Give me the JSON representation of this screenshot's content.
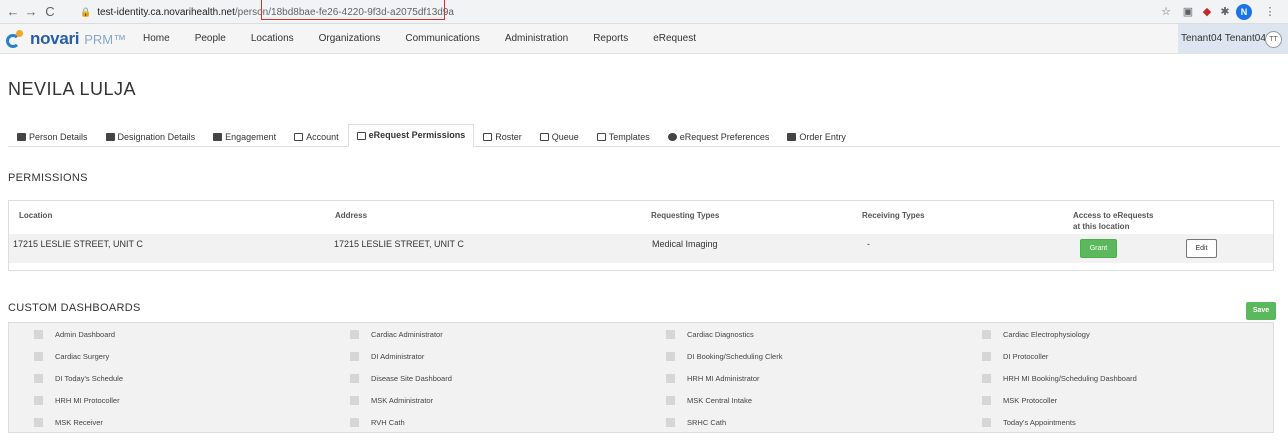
{
  "browser": {
    "back_icon": "←",
    "forward_icon": "→",
    "reload_icon": "C",
    "url_host": "test-identity.ca.novarihealth.net",
    "url_path": "/person/18bd8bae-fe26-4220-9f3d-a2075df13d9a",
    "profile_initial": "N"
  },
  "app": {
    "logo_word": "novari",
    "logo_product": "PRM™",
    "nav": [
      "Home",
      "People",
      "Locations",
      "Organizations",
      "Communications",
      "Administration",
      "Reports",
      "eRequest"
    ],
    "user_name": "Tenant04 Tenant04",
    "user_initials": "TT"
  },
  "person": {
    "name": "NEVILA LULJA"
  },
  "tabs": [
    {
      "label": "Person Details",
      "icon": "person-icon"
    },
    {
      "label": "Designation Details",
      "icon": "id-card-icon"
    },
    {
      "label": "Engagement",
      "icon": "group-icon"
    },
    {
      "label": "Account",
      "icon": "account-icon"
    },
    {
      "label": "eRequest Permissions",
      "icon": "document-icon",
      "active": true
    },
    {
      "label": "Roster",
      "icon": "list-icon"
    },
    {
      "label": "Queue",
      "icon": "list-icon"
    },
    {
      "label": "Templates",
      "icon": "file-icon"
    },
    {
      "label": "eRequest Preferences",
      "icon": "gear-icon"
    },
    {
      "label": "Order Entry",
      "icon": "person-icon"
    }
  ],
  "permissions": {
    "title": "PERMISSIONS",
    "headers": {
      "location": "Location",
      "address": "Address",
      "requesting": "Requesting Types",
      "receiving": "Receiving Types",
      "access_line1": "Access to eRequests",
      "access_line2": "at this location"
    },
    "row": {
      "location": "17215 LESLIE STREET, UNIT C",
      "address": "17215 LESLIE STREET, UNIT C",
      "requesting": "Medical Imaging",
      "receiving": "-",
      "grant_label": "Grant",
      "edit_label": "Edit"
    }
  },
  "dashboards": {
    "title": "CUSTOM DASHBOARDS",
    "save_label": "Save",
    "items": [
      "Admin Dashboard",
      "Cardiac Administrator",
      "Cardiac Diagnostics",
      "Cardiac Electrophysiology",
      "Cardiac Surgery",
      "DI Administrator",
      "DI Booking/Scheduling Clerk",
      "DI Protocoller",
      "DI Today's Schedule",
      "Disease Site Dashboard",
      "HRH MI Administrator",
      "HRH MI Booking/Scheduling Dashboard",
      "HRH MI Protocoller",
      "MSK Administrator",
      "MSK Central Intake",
      "MSK Protocoller",
      "MSK Receiver",
      "RVH Cath",
      "SRHC Cath",
      "Today's Appointments"
    ]
  },
  "colors": {
    "grant": "#5cb85c",
    "highlight": "#d32f2f",
    "brand": "#2a5ea8"
  }
}
